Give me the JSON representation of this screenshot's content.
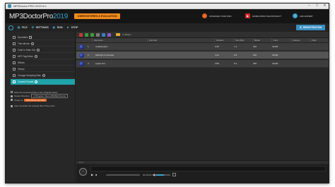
{
  "window": {
    "title": "MP3Doctor PRO 2019 5.0",
    "controls": [
      "–",
      "□",
      "✕"
    ]
  },
  "header": {
    "brand_main": "MP3DoctorPro",
    "brand_year": "2019",
    "banner": "UNREGISTERED & EVALUATION",
    "links": [
      {
        "label": "UPGRADE YOUR PRO",
        "icon": "upgrade-icon",
        "color": "#e0621e"
      },
      {
        "label": "MORE FROM THE PRODUCT",
        "icon": "video-icon",
        "color": "#d02828"
      },
      {
        "label": "ASK EXPERT",
        "icon": "support-icon",
        "color": "#3aa3c9"
      }
    ]
  },
  "toolbar": {
    "items": [
      {
        "label": "FILE",
        "icon": "file-icon"
      },
      {
        "label": "SETTINGS",
        "icon": "gear-icon"
      },
      {
        "label": "RUN",
        "icon": "play-icon"
      },
      {
        "label": "STOP",
        "icon": "stop-icon"
      }
    ],
    "register_label": "REGISTRATION"
  },
  "sidebar": {
    "items": [
      {
        "label": "Normalize",
        "active": false
      },
      {
        "label": "Trim silence",
        "active": false
      },
      {
        "label": "Fade In  Fade Out",
        "active": false
      },
      {
        "label": "MP3 Tag Editor",
        "active": false
      },
      {
        "label": "Effects",
        "active": false
      },
      {
        "label": "Tempo",
        "active": false
      },
      {
        "label": "Change Sampling Rate",
        "active": false
      },
      {
        "label": "Convert Format",
        "active": true
      }
    ],
    "options": {
      "save_original": "Save the processed files in the Original Folder",
      "output_directory": "Output Directory",
      "output_path": "C:\\Program Files (x86)\\Mp3 Doctor",
      "output_to": "Output to",
      "output_format": "Mp3 (Lame encoder)",
      "overwrite": "Auto overwrite the existing files if they exist"
    }
  },
  "grid": {
    "path": "C:\\Music\\",
    "columns": [
      "File Name",
      "File Path",
      "Duration",
      "Size (Mb)",
      "Bitrate",
      "Freq",
      "Channel",
      "Peak"
    ],
    "rows": [
      {
        "num": "1",
        "name": "Collaboration",
        "duration": "3:45",
        "size": "7.2",
        "bitrate": "320",
        "freq": "44100"
      },
      {
        "num": "2",
        "name": "Midnight Crossroad",
        "duration": "4:12",
        "size": "9.6",
        "bitrate": "320",
        "freq": "44100"
      },
      {
        "num": "3",
        "name": "Lights Out",
        "duration": "3:58",
        "size": "8.1",
        "bitrate": "256",
        "freq": "44100"
      }
    ],
    "status": "0 / 0"
  },
  "player": {
    "time": "00:00:00 / 00:00:00",
    "progress": 0.0,
    "volume": 0.55
  }
}
